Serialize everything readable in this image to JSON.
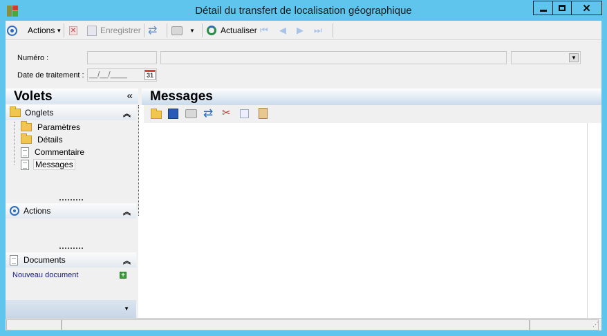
{
  "window": {
    "title": "Détail du transfert de localisation géographique",
    "controls": [
      "minimize",
      "maximize",
      "close"
    ]
  },
  "toolbar": {
    "actions_label": "Actions",
    "save_label": "Enregistrer",
    "refresh_label": "Actualiser"
  },
  "form": {
    "numero_label": "Numéro :",
    "date_label": "Date de traitement :",
    "date_value": "__/__/____",
    "calendar_day": "31"
  },
  "volets": {
    "title": "Volets",
    "collapse_glyph": "«",
    "onglets": {
      "title": "Onglets",
      "items": [
        {
          "label": "Paramètres",
          "icon": "folder-icon"
        },
        {
          "label": "Détails",
          "icon": "folder-icon"
        },
        {
          "label": "Commentaire",
          "icon": "document-icon"
        },
        {
          "label": "Messages",
          "icon": "document-icon"
        }
      ]
    },
    "actions": {
      "title": "Actions"
    },
    "documents": {
      "title": "Documents",
      "new_document": "Nouveau document"
    }
  },
  "messages": {
    "title": "Messages"
  },
  "colors": {
    "window_frame": "#5fc5ec",
    "panel_bg": "#f0f0f0",
    "link": "#1a1a8c"
  }
}
